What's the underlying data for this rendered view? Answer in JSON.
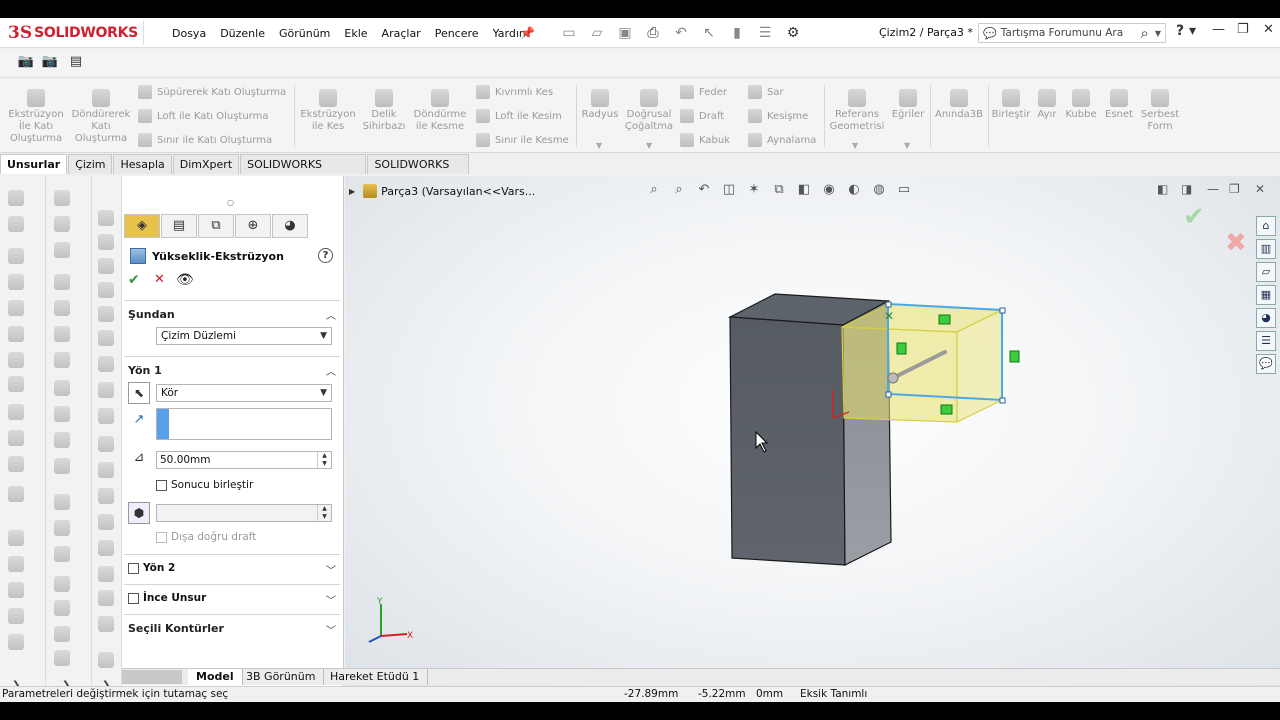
{
  "app": {
    "brand_ds": "3S",
    "brand_name": "SOLIDWORKS"
  },
  "menu": [
    "Dosya",
    "Düzenle",
    "Görünüm",
    "Ekle",
    "Araçlar",
    "Pencere",
    "Yardım"
  ],
  "document_title": "Çizim2 / Parça3 *",
  "search": {
    "placeholder": "Tartışma Forumunu Ara"
  },
  "ribbon": {
    "extrude_boss": "Ekstrüzyon\nİle Katı\nOluşturma",
    "revolve_boss": "Döndürerek\nKatı\nOluşturma",
    "sweep_boss": "Süpürerek Katı Oluşturma",
    "loft_boss": "Loft ile Katı Oluşturma",
    "boundary_boss": "Sınır ile Katı Oluşturma",
    "extrude_cut": "Ekstrüzyon\nile Kes",
    "hole_wizard": "Delik\nSihirbazı",
    "revolve_cut": "Döndürme\nile Kesme",
    "swept_cut": "Kıvrımlı Kes",
    "loft_cut": "Loft ile Kesim",
    "boundary_cut": "Sınır ile Kesme",
    "fillet": "Radyus",
    "linear_pattern": "Doğrusal\nÇoğaltma",
    "rib": "Feder",
    "draft": "Draft",
    "shell": "Kabuk",
    "wrap": "Sar",
    "intersect": "Kesişme",
    "mirror": "Aynalama",
    "reference_geometry": "Referans\nGeometrisi",
    "curves": "Eğriler",
    "instant3d": "Anında3B",
    "combine": "Birleştir",
    "split": "Ayır",
    "dome": "Kubbe",
    "flex": "Esnet",
    "freeform": "Serbest\nForm"
  },
  "tabs": [
    "Unsurlar",
    "Çizim",
    "Hesapla",
    "DimXpert",
    "SOLIDWORKS Eklentileri",
    "SOLIDWORKS MBD"
  ],
  "active_tab": "Unsurlar",
  "property_manager": {
    "title": "Yükseklik-Ekstrüzyon",
    "from_section": "Şundan",
    "from_value": "Çizim Düzlemi",
    "direction1_section": "Yön 1",
    "end_condition": "Kör",
    "depth": "50.00mm",
    "merge_result": "Sonucu birleştir",
    "draft_outward": "Dışa doğru draft",
    "direction2_section": "Yön 2",
    "thin_feature_section": "İnce Unsur",
    "selected_contours_section": "Seçili Kontürler"
  },
  "feature_tree": {
    "part_label": "Parça3  (Varsayılan<<Vars..."
  },
  "bottom_tabs": [
    "Model",
    "3B Görünüm",
    "Hareket Etüdü 1"
  ],
  "status": {
    "message": "Parametreleri değiştirmek için tutamaç seç",
    "x": "-27.89mm",
    "y": "-5.22mm",
    "z": "0mm",
    "state": "Eksik Tanımlı"
  },
  "triad": {
    "x": "X",
    "y": "Y"
  },
  "colors": {
    "brand": "#d02030",
    "preview": "#e8e870",
    "sketch": "#4aa8e8",
    "accent_ok": "#2e9a3a",
    "accent_cancel": "#c8202a"
  }
}
